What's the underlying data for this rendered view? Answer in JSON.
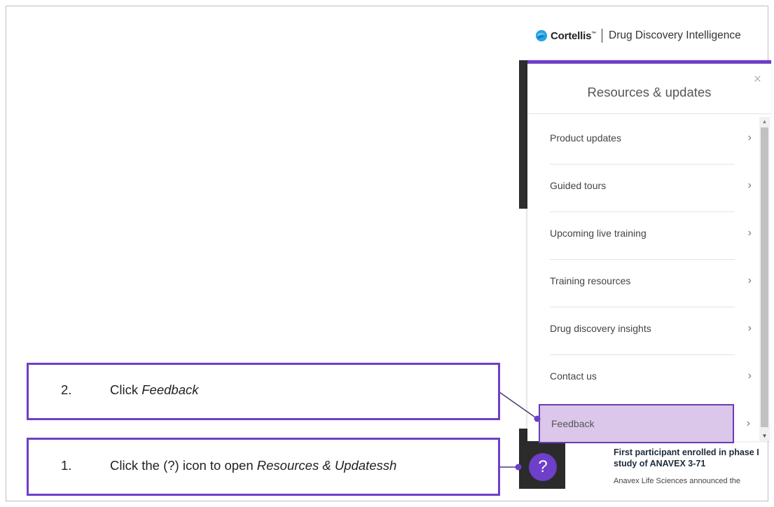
{
  "brand": {
    "name": "Cortellis",
    "tm": "™",
    "product": "Drug Discovery Intelligence"
  },
  "panel": {
    "title": "Resources & updates",
    "close_glyph": "×",
    "items": [
      {
        "label": "Product updates",
        "chevron": "›"
      },
      {
        "label": "Guided tours",
        "chevron": "›"
      },
      {
        "label": "Upcoming live training",
        "chevron": "›"
      },
      {
        "label": "Training resources",
        "chevron": "›"
      },
      {
        "label": "Drug discovery insights",
        "chevron": "›"
      },
      {
        "label": "Contact us",
        "chevron": "›"
      },
      {
        "label": "Feedback",
        "chevron": "›"
      }
    ]
  },
  "article": {
    "title": "First participant enrolled in phase I study of ANAVEX 3-71",
    "description": "Anavex Life Sciences announced the"
  },
  "help_button": {
    "glyph": "?"
  },
  "callouts": {
    "step2": {
      "number": "2.",
      "prefix": "Click ",
      "emphasis": "Feedback",
      "suffix": ""
    },
    "step1": {
      "number": "1.",
      "prefix": "Click the (?) icon to open ",
      "emphasis": "Resources & Updatessh",
      "suffix": ""
    }
  },
  "colors": {
    "accent": "#6e3fc8",
    "highlight": "#dbc7e9"
  },
  "icons": {
    "brand_logo": "cortellis-logo-icon",
    "close": "close-icon",
    "chevron": "chevron-right-icon",
    "help": "help-icon"
  }
}
